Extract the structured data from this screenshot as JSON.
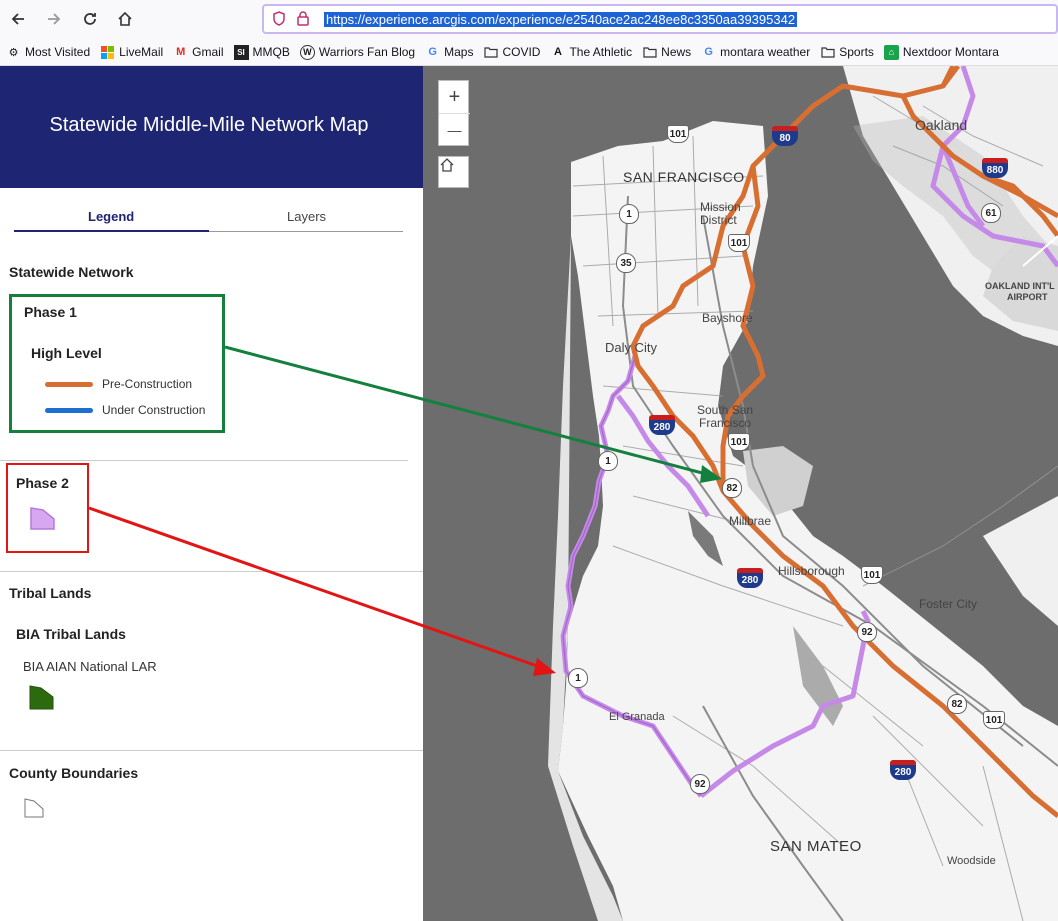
{
  "browser": {
    "url": "https://experience.arcgis.com/experience/e2540ace2ac248ee8c3350aa39395342",
    "bookmarks": [
      {
        "label": "Most Visited",
        "icon": "gear-icon"
      },
      {
        "label": "LiveMail",
        "icon": "windows-icon"
      },
      {
        "label": "Gmail",
        "icon": "gmail-icon"
      },
      {
        "label": "MMQB",
        "icon": "si-icon"
      },
      {
        "label": "Warriors Fan Blog",
        "icon": "wordpress-icon"
      },
      {
        "label": "Maps",
        "icon": "google-icon"
      },
      {
        "label": "COVID",
        "icon": "folder-icon"
      },
      {
        "label": "The Athletic",
        "icon": "athletic-icon"
      },
      {
        "label": "News",
        "icon": "folder-icon"
      },
      {
        "label": "montara weather",
        "icon": "google-icon"
      },
      {
        "label": "Sports",
        "icon": "folder-icon"
      },
      {
        "label": "Nextdoor Montara",
        "icon": "nextdoor-icon"
      }
    ]
  },
  "panel": {
    "title": "Statewide Middle-Mile Network Map",
    "tabs": {
      "legend": "Legend",
      "layers": "Layers"
    },
    "sections": {
      "statewide": "Statewide Network",
      "phase1": "Phase 1",
      "high_level": "High Level",
      "pre_construction": "Pre-Construction",
      "under_construction": "Under Construction",
      "phase2": "Phase 2",
      "tribal": "Tribal Lands",
      "bia_tribal": "BIA Tribal Lands",
      "bia_aian": "BIA AIAN National LAR",
      "county": "County Boundaries"
    },
    "colors": {
      "header": "#1e2573",
      "pre_construction": "#d86f32",
      "under_construction": "#1f6fd1",
      "phase2": "#c58ae8",
      "tribal": "#2d6a0f",
      "annotation_green": "#14803d",
      "annotation_red": "#e31414"
    }
  },
  "map": {
    "zoom_in": "+",
    "zoom_out": "—",
    "home_icon": "home-icon",
    "places": {
      "san_francisco": "SAN FRANCISCO",
      "oakland": "Oakland",
      "mission": "Mission",
      "district": "District",
      "bayshore": "Bayshore",
      "daly_city": "Daly City",
      "south_san": "South San",
      "francisco": "Francisco",
      "millbrae": "Millbrae",
      "hillsborough": "Hillsborough",
      "foster_city": "Foster City",
      "el_granada": "El Granada",
      "san_mateo": "SAN MATEO",
      "woodside": "Woodside",
      "oakland_airport_1": "OAKLAND INT'L",
      "oakland_airport_2": "AIRPORT"
    },
    "shields": {
      "i80": "80",
      "i880": "880",
      "i280a": "280",
      "i280b": "280",
      "i280c": "280",
      "us101a": "101",
      "us101b": "101",
      "us101c": "101",
      "us101d": "101",
      "us101e": "101",
      "ca1a": "1",
      "ca1b": "1",
      "ca1c": "1",
      "ca35": "35",
      "ca61": "61",
      "ca82a": "82",
      "ca82b": "82",
      "ca92a": "92",
      "ca92b": "92"
    }
  }
}
